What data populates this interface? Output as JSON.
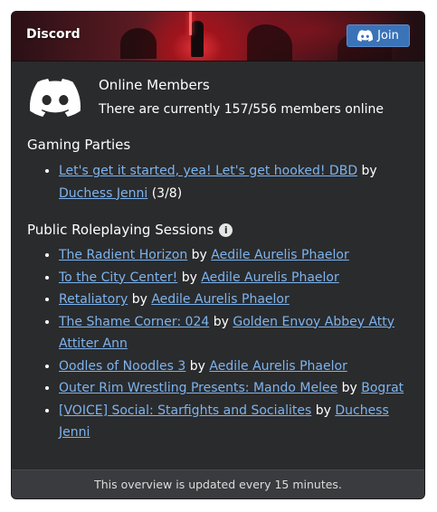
{
  "header": {
    "title": "Discord",
    "join_label": "Join",
    "join_icon": "discord-icon"
  },
  "online": {
    "title": "Online Members",
    "count_text": "There are currently 157/556 members online",
    "logo_icon": "discord-logo-icon"
  },
  "gaming_parties": {
    "title": "Gaming Parties",
    "items": [
      {
        "session": "Let's get it started, yea! Let's get hooked! DBD",
        "by": "by",
        "host": "Duchess Jenni",
        "count": "(3/8)"
      }
    ]
  },
  "roleplay": {
    "title": "Public Roleplaying Sessions",
    "info_icon": "info-icon",
    "items": [
      {
        "session": "The Radient Horizon",
        "by": "by",
        "host": "Aedile Aurelis Phaelor"
      },
      {
        "session": "To the City Center!",
        "by": "by",
        "host": "Aedile Aurelis Phaelor"
      },
      {
        "session": "Retaliatory",
        "by": "by",
        "host": "Aedile Aurelis Phaelor"
      },
      {
        "session": "The Shame Corner: 024",
        "by": "by",
        "host": "Golden Envoy Abbey Atty Attiter Ann"
      },
      {
        "session": "Oodles of Noodles 3",
        "by": "by",
        "host": "Aedile Aurelis Phaelor"
      },
      {
        "session": "Outer Rim Wrestling Presents: Mando Melee",
        "by": "by",
        "host": "Bograt"
      },
      {
        "session": "[VOICE] Social: Starfights and Socialites",
        "by": "by",
        "host": "Duchess Jenni"
      }
    ]
  },
  "footer": {
    "text": "This overview is updated every 15 minutes."
  },
  "colors": {
    "panel": "#2a2b2d",
    "link": "#7db4ee",
    "join_button": "#3a73b8",
    "footer": "#3a3b3e"
  }
}
